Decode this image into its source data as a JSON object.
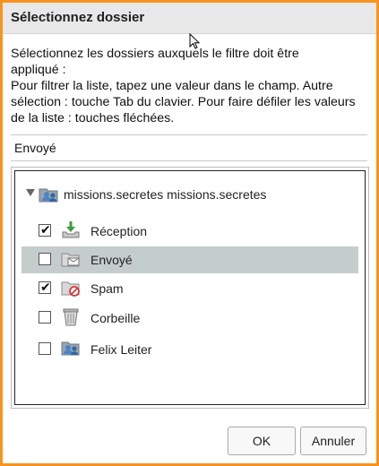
{
  "dialog": {
    "title": "Sélectionnez dossier",
    "description_lines": [
      "Sélectionnez les dossiers auxquels le filtre doit être",
      "appliqué :",
      "Pour filtrer la liste, tapez une valeur dans le champ. Autre",
      "sélection : touche Tab du clavier. Pour faire défiler les valeurs",
      "de la liste : touches fléchées."
    ],
    "filter_value": "Envoyé",
    "tree": {
      "root": {
        "label": "missions.secretes missions.secretes",
        "expanded": true,
        "icon": "account-folder-icon"
      },
      "folders": [
        {
          "label": "Réception",
          "checked": true,
          "selected": false,
          "icon": "inbox-icon"
        },
        {
          "label": "Envoyé",
          "checked": false,
          "selected": true,
          "icon": "sent-folder-icon"
        },
        {
          "label": "Spam",
          "checked": true,
          "selected": false,
          "icon": "spam-folder-icon"
        },
        {
          "label": "Corbeille",
          "checked": false,
          "selected": false,
          "icon": "trash-icon"
        },
        {
          "label": "Felix Leiter",
          "checked": false,
          "selected": false,
          "icon": "shared-folder-icon"
        }
      ]
    },
    "buttons": {
      "ok": "OK",
      "cancel": "Annuler"
    },
    "colors": {
      "border": "#f7931e",
      "title_bar": "#e8e8e8",
      "selected_row": "#c5cdcc"
    }
  }
}
